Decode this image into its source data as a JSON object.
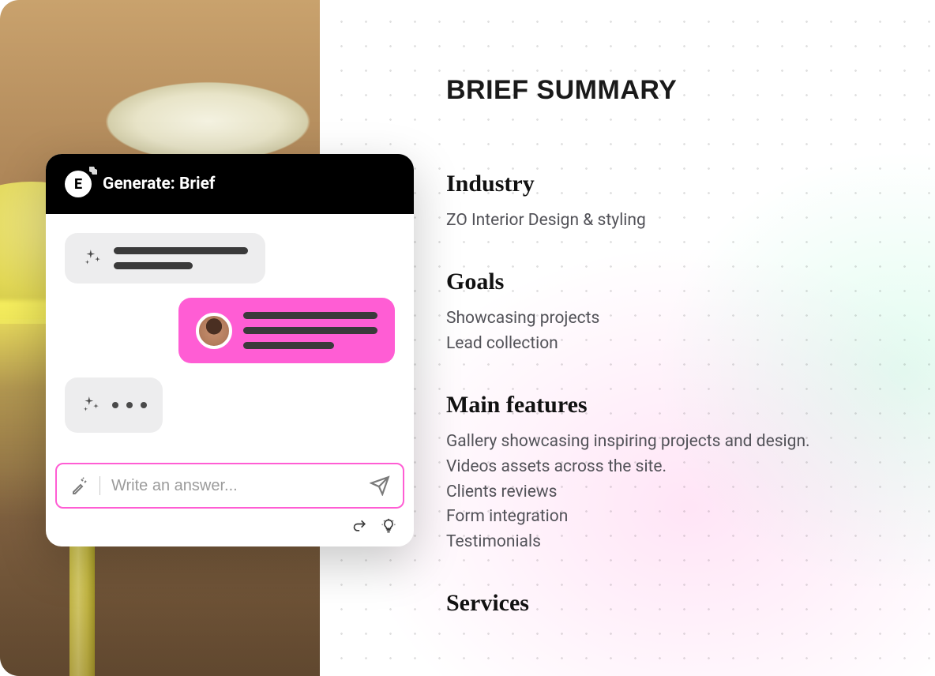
{
  "chat": {
    "title": "Generate: Brief",
    "logo_letter": "E",
    "input_placeholder": "Write an answer..."
  },
  "summary": {
    "title": "BRIEF SUMMARY",
    "sections": {
      "industry": {
        "heading": "Industry",
        "value": "ZO Interior Design & styling"
      },
      "goals": {
        "heading": "Goals",
        "items": [
          "Showcasing projects",
          "Lead collection"
        ]
      },
      "features": {
        "heading": "Main features",
        "items": [
          "Gallery showcasing inspiring projects and design.",
          "Videos assets across the site.",
          "Clients reviews",
          "Form integration",
          "Testimonials"
        ]
      },
      "services": {
        "heading": "Services"
      }
    }
  }
}
